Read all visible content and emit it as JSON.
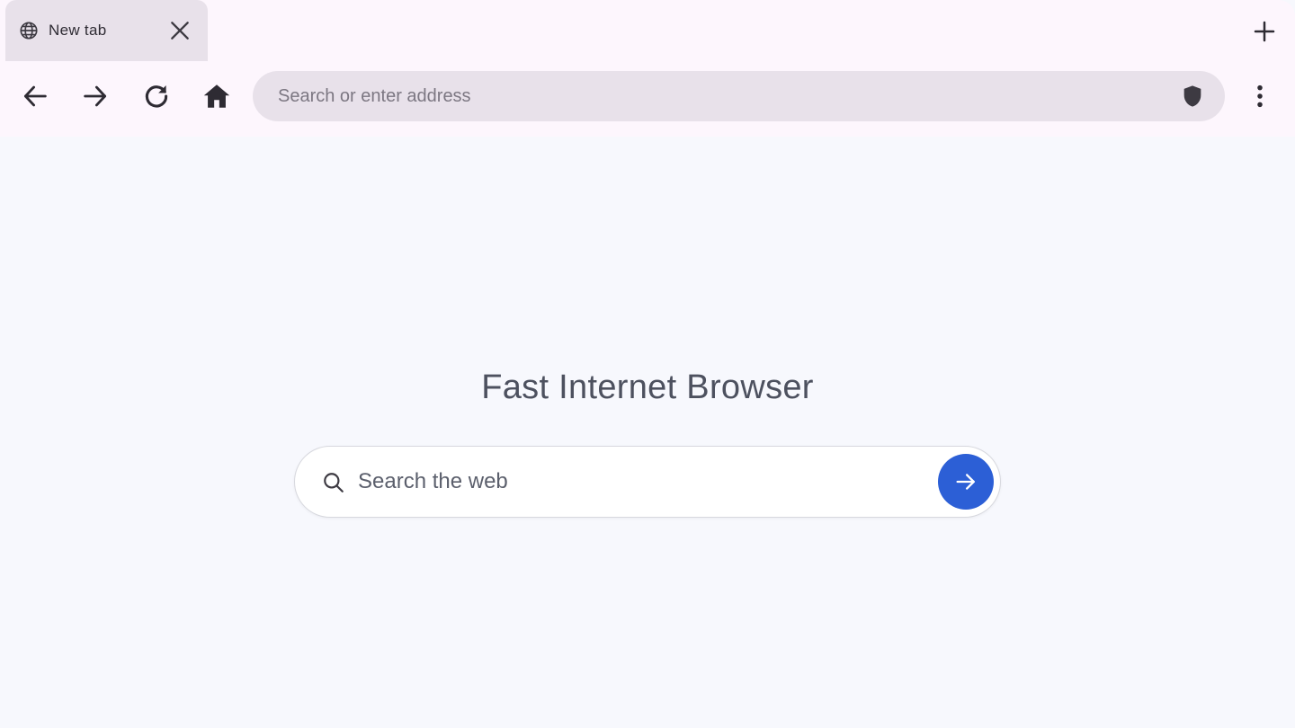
{
  "tab": {
    "title": "New tab",
    "icon": "globe-icon",
    "close_icon": "close-icon"
  },
  "toolbar": {
    "back_icon": "back-arrow-icon",
    "forward_icon": "forward-arrow-icon",
    "reload_icon": "reload-icon",
    "home_icon": "home-icon",
    "new_tab_icon": "plus-icon",
    "menu_icon": "more-vert-icon"
  },
  "address_bar": {
    "placeholder": "Search or enter address",
    "value": "",
    "shield_icon": "shield-icon"
  },
  "home_page": {
    "title": "Fast Internet Browser",
    "search": {
      "placeholder": "Search the web",
      "value": "",
      "search_icon": "search-icon",
      "go_icon": "arrow-right-icon"
    }
  },
  "colors": {
    "chrome_bg": "#fdf6fd",
    "tab_bg": "#e8e1ea",
    "content_bg": "#f7f8fd",
    "accent": "#2c5fd6",
    "title_text": "#4d515f"
  }
}
